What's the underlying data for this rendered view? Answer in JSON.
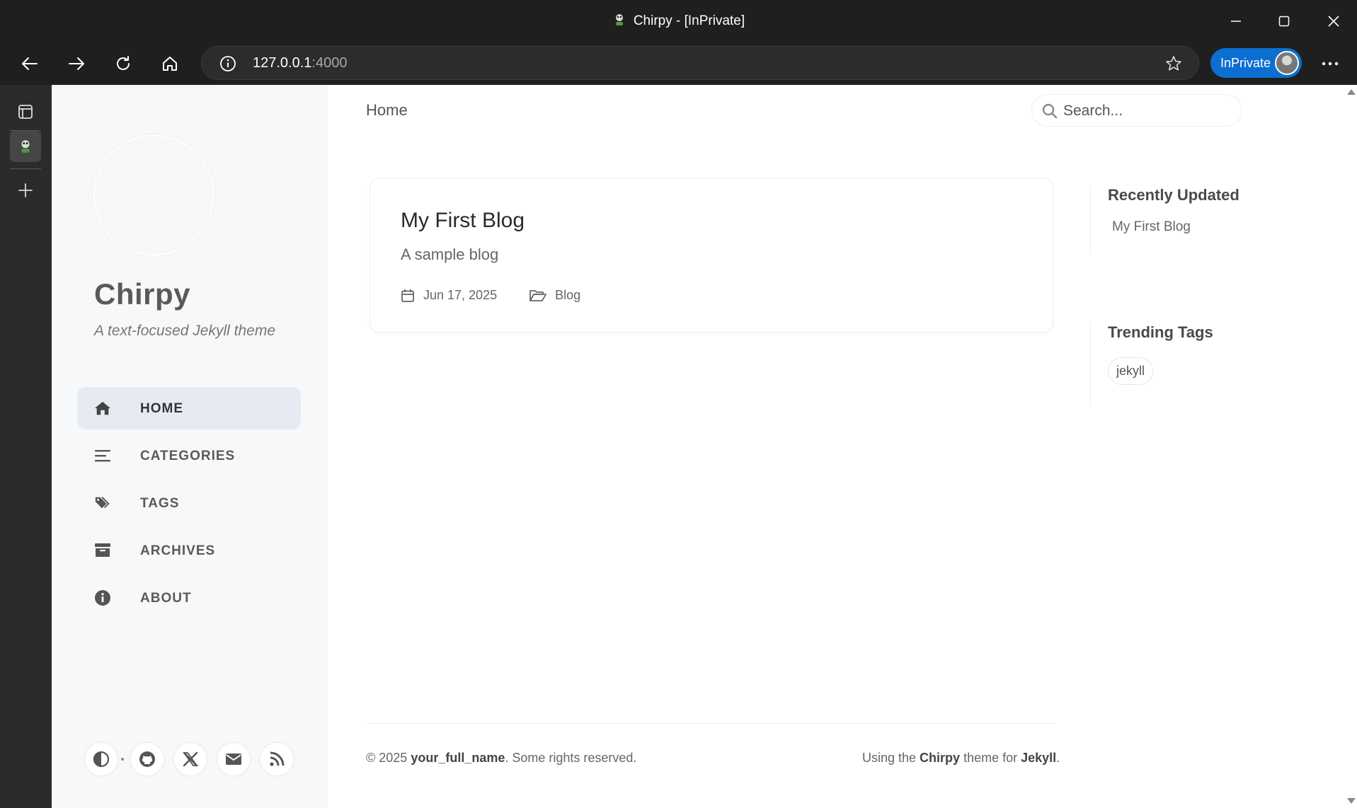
{
  "browser": {
    "window_title": "Chirpy - [InPrivate]",
    "url_host": "127.0.0.1",
    "url_port": ":4000",
    "inprivate_label": "InPrivate",
    "icons": [
      "back-icon",
      "forward-icon",
      "refresh-icon",
      "home-icon",
      "info-icon",
      "favorite-star-icon",
      "more-icon",
      "minimize-icon",
      "maximize-icon",
      "close-icon",
      "tab-actions-icon",
      "new-tab-icon"
    ]
  },
  "sidebar": {
    "site_title": "Chirpy",
    "site_subtitle": "A text-focused Jekyll theme",
    "nav": [
      {
        "label": "HOME",
        "icon": "home-icon",
        "active": true
      },
      {
        "label": "CATEGORIES",
        "icon": "list-icon",
        "active": false
      },
      {
        "label": "TAGS",
        "icon": "tags-icon",
        "active": false
      },
      {
        "label": "ARCHIVES",
        "icon": "archive-icon",
        "active": false
      },
      {
        "label": "ABOUT",
        "icon": "info-circle-icon",
        "active": false
      }
    ],
    "social_icons": [
      "theme-toggle-icon",
      "github-icon",
      "x-twitter-icon",
      "email-icon",
      "rss-icon"
    ]
  },
  "topbar": {
    "breadcrumb": "Home",
    "search_placeholder": "Search..."
  },
  "post": {
    "title": "My First Blog",
    "description": "A sample blog",
    "date": "Jun 17, 2025",
    "category": "Blog"
  },
  "panels": {
    "recently_updated_title": "Recently Updated",
    "recently_updated": [
      "My First Blog"
    ],
    "trending_tags_title": "Trending Tags",
    "trending_tags": [
      "jekyll"
    ]
  },
  "footer": {
    "copyright_prefix": "© 2025 ",
    "author": "your_full_name",
    "copyright_suffix": ". Some rights reserved.",
    "using_prefix": "Using the ",
    "theme_name": "Chirpy",
    "using_middle": " theme for ",
    "engine": "Jekyll",
    "using_suffix": "."
  },
  "colors": {
    "accent_inprivate": "#0b6fd1",
    "sidebar_bg": "#f6f8fa",
    "nav_active_bg": "#e6ebf3"
  }
}
